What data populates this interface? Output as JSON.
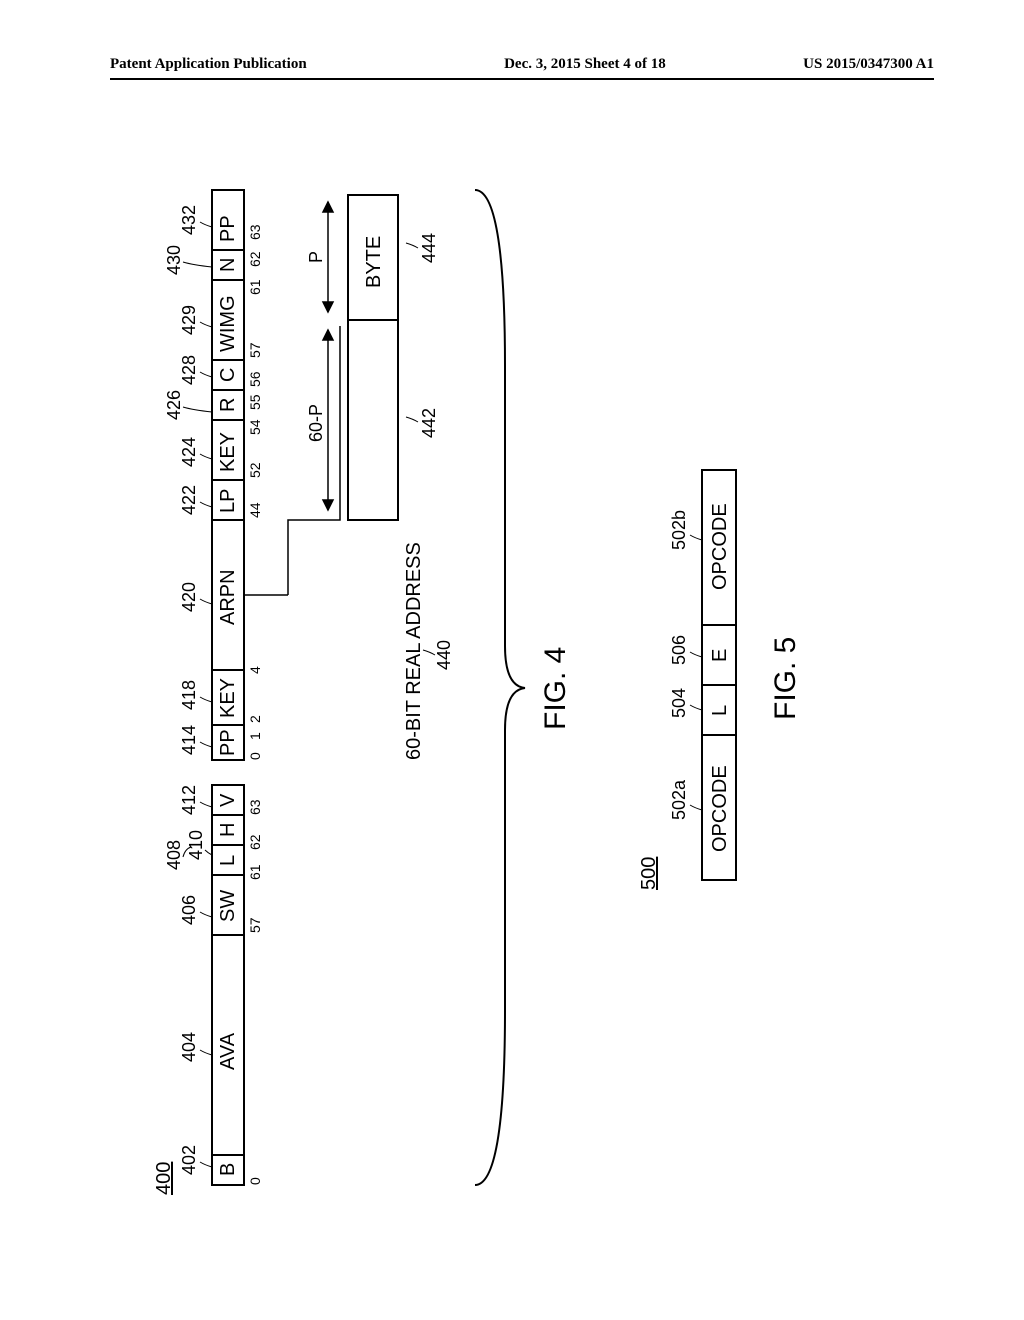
{
  "header": {
    "left": "Patent Application Publication",
    "center": "Dec. 3, 2015  Sheet 4 of 18",
    "right": "US 2015/0347300 A1"
  },
  "fig4": {
    "overall_label": "400",
    "caption": "FIG. 4",
    "dword0": {
      "label402": "402",
      "label404": "404",
      "label406": "406",
      "label408": "408",
      "label410": "410",
      "label412": "412",
      "fields": {
        "B": "B",
        "AVA": "AVA",
        "SW": "SW",
        "L": "L",
        "H": "H",
        "V": "V"
      },
      "bits": {
        "b0": "0",
        "b57": "57",
        "b61": "61",
        "b62": "62",
        "b63": "63"
      }
    },
    "dword1": {
      "label414": "414",
      "label418": "418",
      "label420": "420",
      "label422": "422",
      "label424": "424",
      "label426": "426",
      "label428": "428",
      "label429": "429",
      "label430": "430",
      "label432": "432",
      "fields": {
        "PP": "PP",
        "KEY": "KEY",
        "ARPN": "ARPN",
        "LP": "LP",
        "KEY2": "KEY",
        "R": "R",
        "C": "C",
        "WIMG": "WIMG",
        "N": "N",
        "PP2": "PP"
      },
      "bits": {
        "b0": "0",
        "b1": "1",
        "b2": "2",
        "b4": "4",
        "b44": "44",
        "b52": "52",
        "b54": "54",
        "b55": "55",
        "b56": "56",
        "b57": "57",
        "b61": "61",
        "b62": "62",
        "b63": "63"
      }
    },
    "real_addr": {
      "label440": "440",
      "label442": "442",
      "label444": "444",
      "text": "60-BIT REAL ADDRESS",
      "range": "60-P",
      "p": "P",
      "byte": "BYTE"
    }
  },
  "fig5": {
    "overall_label": "500",
    "caption": "FIG. 5",
    "label502a": "502a",
    "label504": "504",
    "label506": "506",
    "label502b": "502b",
    "fields": {
      "OPCODEa": "OPCODE",
      "L": "L",
      "E": "E",
      "OPCODEb": "OPCODE"
    }
  }
}
